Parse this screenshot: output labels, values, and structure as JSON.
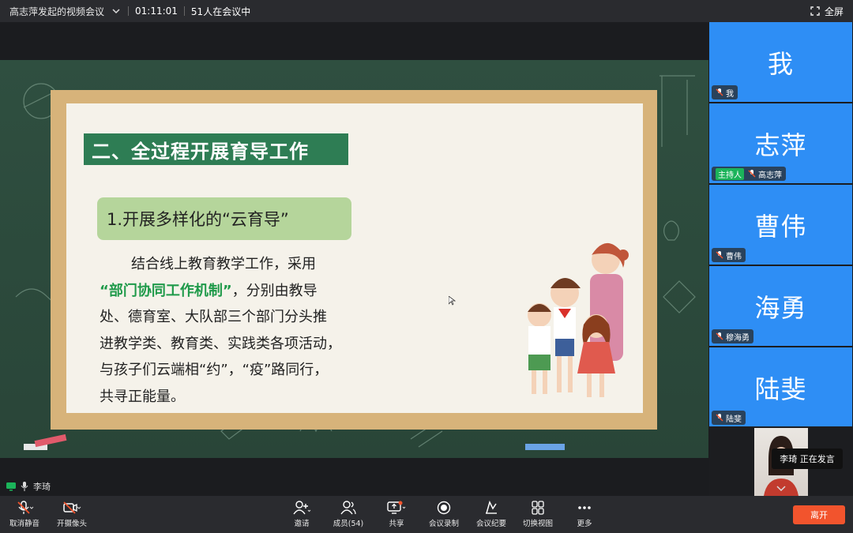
{
  "topbar": {
    "title": "高志萍发起的视频会议",
    "duration": "01:11:01",
    "participants_text": "51人在会议中",
    "fullscreen_label": "全屏"
  },
  "slide": {
    "heading": "二、全过程开展育导工作",
    "subheading": "1.开展多样化的“云育导”",
    "line1": "结合线上教育教学工作，采用",
    "line2_hl": "“部门协同工作机制”",
    "line2_rest": "，分别由教导",
    "line3": "处、德育室、大队部三个部门分头推",
    "line4": "进教学类、教育类、实践类各项活动，",
    "line5": "与孩子们云端相“约”，“疫”路同行，",
    "line6": "共寻正能量。"
  },
  "active_speaker": {
    "name": "李琦"
  },
  "tiles": [
    {
      "display": "我",
      "label": "我",
      "host": ""
    },
    {
      "display": "志萍",
      "label": "高志萍",
      "host": "主持人"
    },
    {
      "display": "曹伟",
      "label": "曹伟",
      "host": ""
    },
    {
      "display": "海勇",
      "label": "穆海勇",
      "host": ""
    },
    {
      "display": "陆斐",
      "label": "陆斐",
      "host": ""
    }
  ],
  "camera_tile": {
    "speaking": "李琦  正在发言"
  },
  "toolbar": {
    "unmute": "取消静音",
    "camera": "开摄像头",
    "invite": "邀请",
    "members": "成员(54)",
    "share": "共享",
    "record": "会议录制",
    "minutes": "会议纪要",
    "view": "切换视图",
    "more": "更多",
    "leave": "离开"
  },
  "colors": {
    "tile_blue": "#2e8ef5",
    "heading_green": "#2e7d54",
    "highlight_green": "#1f9a4a",
    "leave_orange": "#f2542d",
    "host_green": "#1bb35a"
  }
}
